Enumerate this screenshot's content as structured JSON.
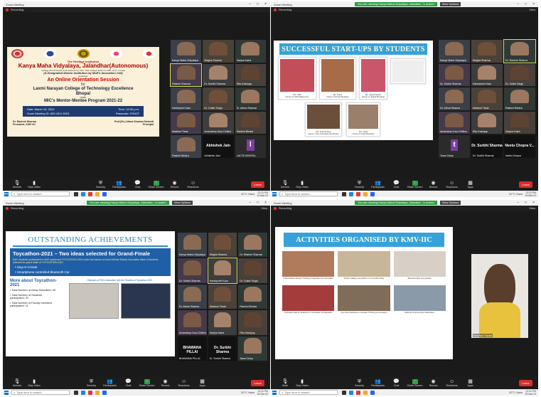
{
  "window_title": "Zoom Meeting",
  "recording_label": "Recording",
  "view_label": "View",
  "viewing_banner": {
    "text": "You are viewing Kanya Maha Vidyalaya, Jalandha...'s screen",
    "options": "View Options"
  },
  "window_controls": [
    "–",
    "□",
    "×"
  ],
  "toolbar": {
    "unmute": "Unmute",
    "stop_video": "Stop Video",
    "mute": "Mute",
    "security": "Security",
    "participants": "Participants",
    "participants_count": "55",
    "chat": "Chat",
    "chat_badge": "10",
    "share_screen": "Share Screen",
    "record": "Record",
    "reactions": "Reactions",
    "apps": "Apps",
    "end": "Leave"
  },
  "taskbar": {
    "search_placeholder": "Type here to search",
    "weather": "32°C Haze",
    "time": "12:31 PM",
    "date": "19-Mar-22"
  },
  "slide1": {
    "institution_tag": "The Heritage Institution",
    "college": "Kanya Maha Vidyalaya, Jalandhar(Autonomous)",
    "affiliation": "College with Potential for Excellence by UGC, Star College Status by DBT, Govt. of India",
    "iic": "(A Designated Mentor Institution by MoE's Innovation Cell)",
    "organises": "organises",
    "event": "An Online Orientation Session",
    "for": "for",
    "target_college": "Laxmi Narayan College of Technology Excellence",
    "city": "Bhopal",
    "under": "under",
    "program": "MIC's Mentor-Mentee Program 2021-22",
    "date": "Date: March 19, 2022",
    "time": "Time: 12:30 p.m.",
    "meeting_id": "Zoom Meeting ID: 825 4311 5023",
    "passcode": "Passcode: 576437",
    "president_name": "Dr. Rashmi Sharma",
    "president_title": "President, KMV IIC",
    "principal_name": "Prof.(Dr.) Atima Sharma Dwivedi",
    "principal_title": "Principal"
  },
  "q1_participants": [
    {
      "name": "Kanya Maha Vidyalaya"
    },
    {
      "name": "Megha Sharma"
    },
    {
      "name": "Sanjna Kalra"
    },
    {
      "name": "Rashmi Sharma",
      "highlight": true
    },
    {
      "name": "Dr. Surbhi Sharma"
    },
    {
      "name": "Ritu Kashyap"
    },
    {
      "name": "Harshpreet Kaur"
    },
    {
      "name": "Dr. Gulbir Singh"
    },
    {
      "name": "Dr. Atima Sharma"
    },
    {
      "name": "Madhuri Tiwari"
    },
    {
      "name": "Amandeep Kaur Dhillon"
    },
    {
      "name": "Rashmi Bindra"
    },
    {
      "name": "Rashmi Bindra"
    },
    {
      "name": "Abhishek Jain",
      "text_tile": "Abhishek Jain"
    },
    {
      "name": "LNCTE BHOPAL",
      "purple": true
    }
  ],
  "slide2": {
    "title": "SUCCESSFUL START-UPS BY STUDENTS",
    "photos": [
      {
        "cap1": "Ms. Vidhi",
        "cap2": "Owner of Vidhi Makeovers"
      },
      {
        "cap1": "Ms. Preeti",
        "cap2": "Owner of Preeti Boutique"
      },
      {
        "cap1": "Ms. Jaspal Sekhri",
        "cap2": "Owner of Jaspal Boutique"
      },
      {
        "cap1": "Ms. Aamrita Kaur",
        "cap2": "Owner of My Chocolate Mj Wonder"
      },
      {
        "cap1": "Ms. Anjali",
        "cap2": "Owner of Anjali Boutique"
      }
    ]
  },
  "q2_participants": [
    {
      "name": "Kanya Maha Vidyalaya"
    },
    {
      "name": "Megha Sharma"
    },
    {
      "name": "Dr. Rashmi Sharma",
      "highlight": true
    },
    {
      "name": "Dr. Surbhi Sharma"
    },
    {
      "name": "Harshpreet Kaur"
    },
    {
      "name": "Dr. Gulbir Singh"
    },
    {
      "name": "Dr. Atima Sharma"
    },
    {
      "name": "Madhuri Tiwari"
    },
    {
      "name": "Rashmi Bindra"
    },
    {
      "name": "Amandeep Kaur Dhillon"
    },
    {
      "name": "Ritu Kashyap"
    },
    {
      "name": "Sanjna Kalra"
    },
    {
      "name": "Tarun Deep",
      "purple": true
    },
    {
      "name": "Dr. Surbhi Sharma",
      "text_tile": "Dr. Surbhi Sharma"
    },
    {
      "name": "Neetu Chopra",
      "text_tile": "Neetu Chopra V..."
    }
  ],
  "slide3": {
    "title": "OUTSTANDING ACHIEVEMENTS",
    "headline": "Toycathon-2021 – Two ideas selected for Grand-Finale",
    "para": "KMV students participated in MoE sponsored TOYCATHON-2021 under the banner of Atma Nirbhar Bharat. Innovative ideas of students selected for grand finale of TOYCATHON-2021:",
    "ideas": [
      "Seg-re-Create",
      "Smartphone controlled Bluetooth Car"
    ],
    "more_title": "More about Toycathon-2021",
    "facts": [
      "Total Number of Ideas Submitted: 09",
      "Total Number of Students participated: 22",
      "Total Number of Faculty members participated: 11"
    ],
    "glimpses": "Glimpses of PM's Interaction with the Finalists of Toycathon-2021"
  },
  "q3_participants": [
    {
      "name": "Kanya Maha Vidyalaya"
    },
    {
      "name": "Megha Sharma"
    },
    {
      "name": "Dr. Rashmi Sharma"
    },
    {
      "name": "Dr. Surbhi Sharma"
    },
    {
      "name": "Harshpreet Kaur",
      "highlight": true
    },
    {
      "name": "Dr. Gulbir Singh"
    },
    {
      "name": "Dr. Atima Sharma"
    },
    {
      "name": "Madhuri Tiwari"
    },
    {
      "name": "Rashmi Bindra"
    },
    {
      "name": "Amandeep Kaur Dhillon"
    },
    {
      "name": "Sanjna Kalra"
    },
    {
      "name": "Ritu Kashyap"
    },
    {
      "name": "BHAWANA PILLAI",
      "text_tile": "BHAWANA PILLAI"
    },
    {
      "name": "Dr. Surbhi Sharma",
      "text_tile": "Dr. Surbhi Sharma"
    },
    {
      "name": "Tarun Deep"
    }
  ],
  "slide4": {
    "title": "ACTIVITIES ORGANISED BY KMV-IIC",
    "activities": [
      "Intra-Institute Design Thinking Competition on Innovation",
      "Poster making competition on Innovation Day",
      "Business Plan Competition",
      "Innovation talk by Students on Innovation Ambassador",
      "One Day Workshop on Design Thinking & Innovation",
      "National Science Day Celebration"
    ]
  },
  "q4_participants": [
    {
      "name": "Madhuri Tiwari"
    }
  ],
  "colors": {
    "accent": "#2ea043",
    "record": "#e33333",
    "slide_banner": "#36a2d8",
    "dark_blue": "#1f5fa8"
  }
}
